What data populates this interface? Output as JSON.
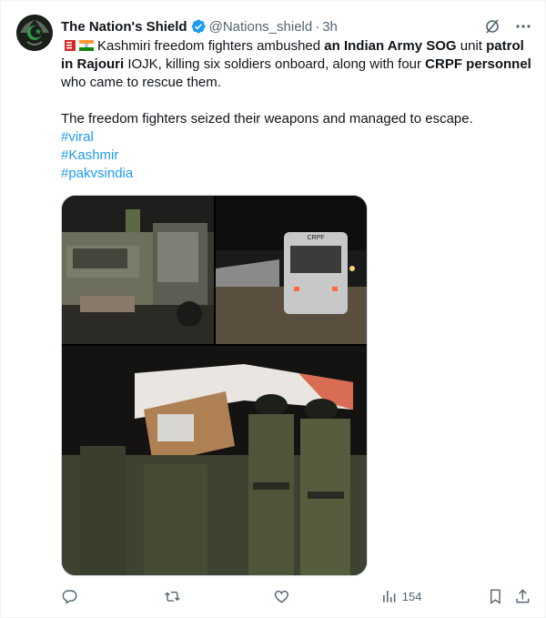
{
  "author": {
    "name": "The Nation's Shield",
    "handle": "@Nations_shield",
    "separator": "·",
    "time": "3h",
    "verified": true
  },
  "tweet": {
    "s1": "Kashmiri freedom fighters ambushed ",
    "b1": "an Indian Army SOG",
    "s2": " unit ",
    "b2": "patrol in Rajouri",
    "s3": " IOJK, killing six soldiers onboard, along with four ",
    "b3": "CRPF personnel",
    "s4": " who came to rescue them.",
    "para2": "The freedom fighters seized their weapons and managed to escape.",
    "hashtags": [
      "#viral",
      "#Kashmir",
      "#pakvsindia"
    ]
  },
  "media": {
    "photo1_caption": "",
    "photo2_vehicle_text": "CRPF"
  },
  "actions": {
    "views": "154"
  },
  "icons": {
    "avatar": "crescent-star-logo",
    "verified": "verified-badge-icon",
    "grok": "grok-icon",
    "more": "more-icon",
    "reply": "reply-icon",
    "retweet": "retweet-icon",
    "like": "like-icon",
    "views": "views-icon",
    "bookmark": "bookmark-icon",
    "share": "share-icon"
  },
  "colors": {
    "accent": "#1d9bf0",
    "text": "#0f1419",
    "muted": "#536471"
  }
}
